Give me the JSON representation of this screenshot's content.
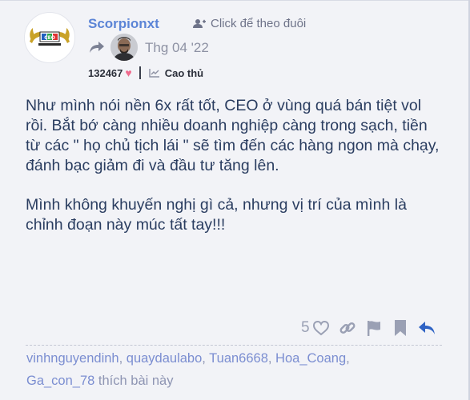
{
  "author": {
    "username": "Scorpionxt",
    "follow_label": "Click để theo đuôi",
    "date": "Thg 04 '22",
    "points": "132467",
    "rank": "Cao thủ",
    "avatar_logo_text": "CEO"
  },
  "post": {
    "paragraphs": [
      "Như mình nói nền 6x rất tốt, CEO ở vùng quá bán tiệt vol rồi. Bắt bớ càng nhiều doanh nghiệp càng trong sạch, tiền từ các \" họ chủ tịch lái \" sẽ tìm đến các hàng ngon mà chạy, đánh bạc giảm đi và đầu tư tăng lên.",
      "Mình không khuyến nghị gì cả, nhưng vị trí của mình là chỉnh đoạn này múc tất tay!!!"
    ]
  },
  "actions": {
    "like_count": "5",
    "icons": [
      "heart-icon",
      "link-icon",
      "flag-icon",
      "bookmark-icon",
      "reply-icon"
    ]
  },
  "likes": {
    "users": [
      "vinhnguyendinh",
      "quaydaulabo",
      "Tuan6668",
      "Hoa_Coang",
      "Ga_con_78"
    ],
    "suffix": "thích bài này"
  },
  "colors": {
    "background": "#f2f3f7",
    "username": "#5b84d6",
    "body_text": "#2a3d60",
    "reply_icon": "#2f63c4",
    "heart": "#f06b8e"
  }
}
